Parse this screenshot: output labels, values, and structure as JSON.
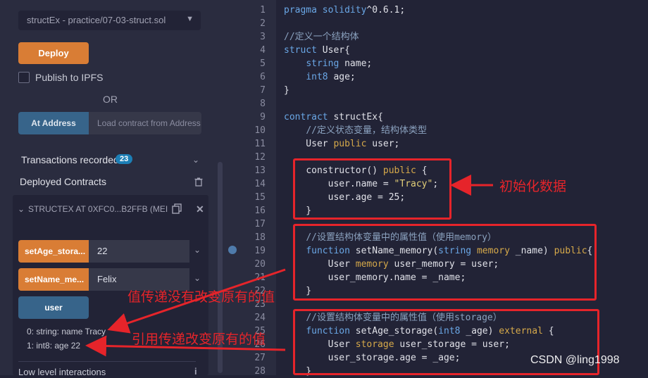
{
  "left_panel": {
    "contract_select": "structEx - practice/07-03-struct.sol",
    "deploy_label": "Deploy",
    "publish_label": "Publish to IPFS",
    "or_label": "OR",
    "at_address_label": "At Address",
    "load_contract_placeholder": "Load contract from Address",
    "transactions_label": "Transactions recorded",
    "transactions_count": "23",
    "deployed_label": "Deployed Contracts",
    "contract_title": "STRUCTEX AT 0XFC0...B2FFB (MEI",
    "functions": [
      {
        "label": "setAge_stora...",
        "value": "22"
      },
      {
        "label": "setName_me...",
        "value": "Felix"
      }
    ],
    "user_button": "user",
    "outputs": [
      "0: string: name Tracy",
      "1: int8: age 22"
    ],
    "low_level_label": "Low level interactions",
    "colors": {
      "deploy": "#d97d35",
      "at_address": "#37648a",
      "badge": "#1c7fb6"
    }
  },
  "editor": {
    "line_numbers": [
      "1",
      "2",
      "3",
      "4",
      "5",
      "6",
      "7",
      "8",
      "9",
      "10",
      "11",
      "12",
      "13",
      "14",
      "15",
      "16",
      "17",
      "18",
      "19",
      "20",
      "21",
      "22",
      "23",
      "24",
      "25",
      "26",
      "27",
      "28"
    ]
  },
  "annotations": {
    "init_data": "初始化数据",
    "value_pass": "值传递没有改变原有的值",
    "ref_pass": "引用传递改变原有的值",
    "color": "#e6242a"
  },
  "watermark": "CSDN @ling1998"
}
